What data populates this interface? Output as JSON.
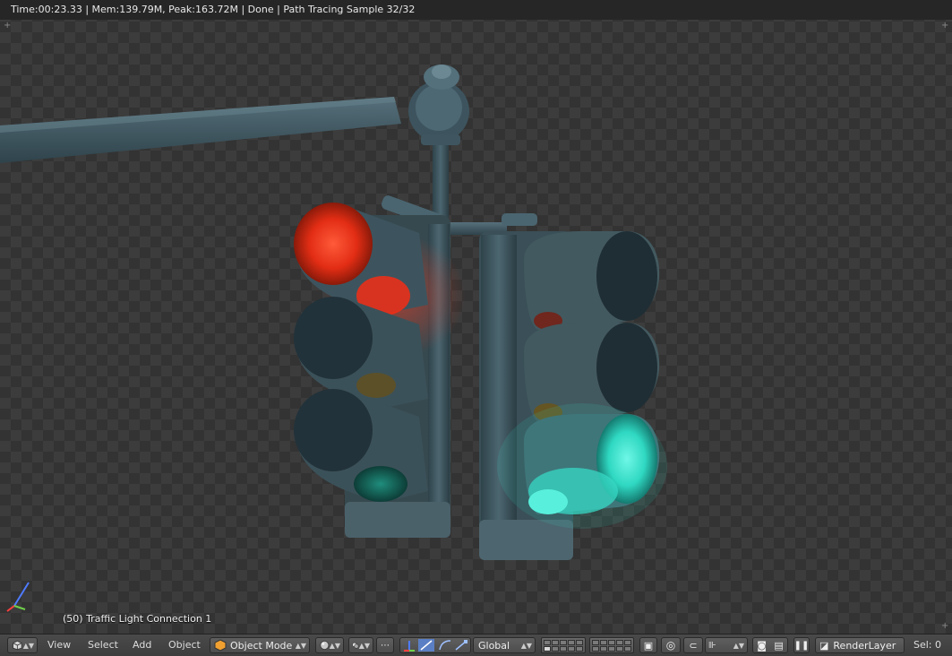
{
  "render_status": "Time:00:23.33 | Mem:139.79M, Peak:163.72M | Done | Path Tracing Sample 32/32",
  "active_object_label": "(50) Traffic Light Connection 1",
  "header": {
    "menus": [
      "View",
      "Select",
      "Add",
      "Object"
    ],
    "mode": "Object Mode",
    "transform_orientation": "Global",
    "render_layer": "RenderLayer",
    "selection_count": "Sel: 0"
  },
  "icons": {
    "editor_type": "3d-view-cube-icon",
    "mode": "object-cube-icon",
    "shading": "solid-sphere-icon",
    "pivot": "pivot-point-icon",
    "manipulator": "manipulator-axes-icon",
    "snap": "magnet-icon",
    "camera": "camera-icon",
    "clapper": "clapperboard-icon",
    "pause": "pause-icon",
    "render_layer": "render-layer-icon"
  },
  "colors": {
    "red_lamp": "#ff3a1e",
    "green_lamp": "#2fe6cf",
    "housing": "#3f5660"
  }
}
